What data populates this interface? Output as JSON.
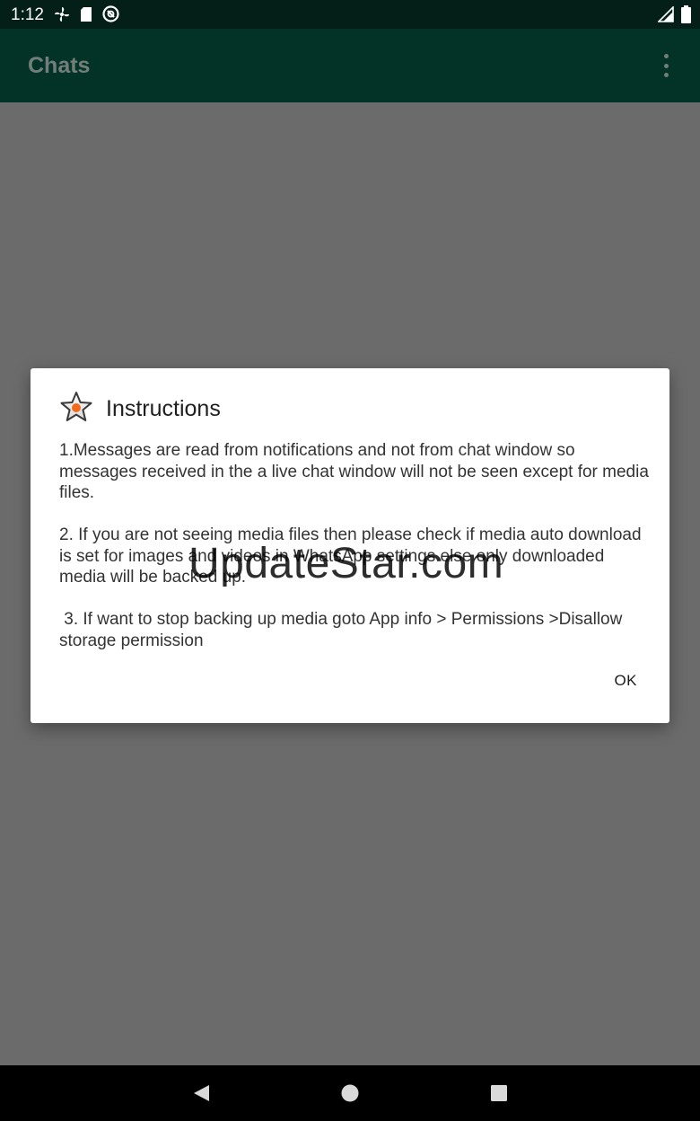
{
  "status_bar": {
    "time": "1:12",
    "icons_left": [
      "fan-icon",
      "sd-card-icon",
      "sync-icon"
    ],
    "icons_right": [
      "signal-icon",
      "battery-icon"
    ]
  },
  "app_bar": {
    "title": "Chats",
    "menu_icon": "more-vert-icon"
  },
  "dialog": {
    "icon": "star-icon",
    "title": "Instructions",
    "paragraphs": [
      "1.Messages are read from notifications and not from chat window so messages received in the a live chat window will not be seen except for media files.",
      "2. If you are not seeing media files then please check if media auto download is set for images and videos in WhatsApp settings else only downloaded media will be backed up.",
      " 3. If want to stop backing up media goto App info > Permissions >Disallow storage permission"
    ],
    "ok_label": "OK"
  },
  "watermark": "UpdateStar.com",
  "nav_bar": {
    "buttons": [
      "back-icon",
      "home-icon",
      "recents-icon"
    ]
  },
  "colors": {
    "status_bar": "#031f17",
    "app_bar": "#033327",
    "scrim": "#6b6b6b",
    "star_orange": "#f26b1d"
  }
}
